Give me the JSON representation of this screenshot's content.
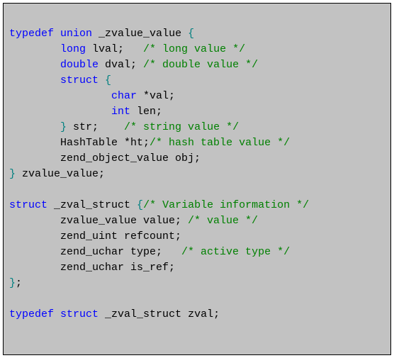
{
  "code": {
    "l1": {
      "k1": "typedef",
      "k2": "union",
      "id": " _zvalue_value ",
      "b": "{"
    },
    "l2": {
      "k": "long",
      "id": " lval;   ",
      "c": "/* long value */"
    },
    "l3": {
      "k": "double",
      "id": " dval; ",
      "c": "/* double value */"
    },
    "l4": {
      "k": "struct",
      "sp": " ",
      "b": "{"
    },
    "l5": {
      "k": "char",
      "id": " *val;"
    },
    "l6": {
      "k": "int",
      "id": " len;"
    },
    "l7": {
      "b": "}",
      "id": " str;    ",
      "c": "/* string value */"
    },
    "l8": {
      "id": "HashTable *ht;",
      "c": "/* hash table value */"
    },
    "l9": {
      "id": "zend_object_value obj;"
    },
    "l10": {
      "b": "}",
      "id": " zvalue_value;"
    },
    "blank1": "",
    "l11": {
      "k": "struct",
      "id": " _zval_struct ",
      "b": "{",
      "c": "/* Variable information */"
    },
    "l12": {
      "id": "zvalue_value value; ",
      "c": "/* value */"
    },
    "l13": {
      "id": "zend_uint refcount;"
    },
    "l14": {
      "id": "zend_uchar type;   ",
      "c": "/* active type */"
    },
    "l15": {
      "id": "zend_uchar is_ref;"
    },
    "l16": {
      "b": "}",
      "id": ";"
    },
    "blank2": "",
    "l17": {
      "k1": "typedef",
      "k2": "struct",
      "id": " _zval_struct zval;"
    }
  }
}
